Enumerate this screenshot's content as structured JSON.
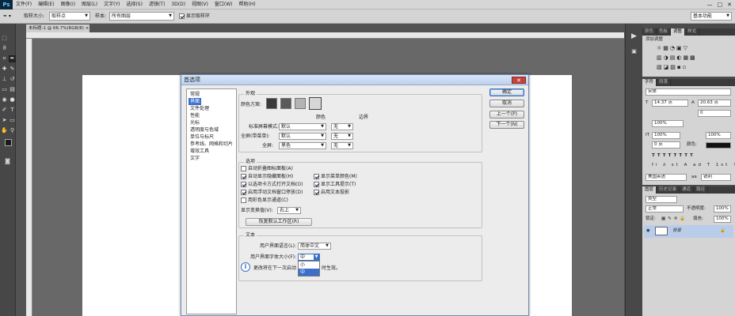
{
  "app": {
    "logo": "Ps",
    "window_controls": [
      "—",
      "□",
      "✕"
    ]
  },
  "menu": [
    "文件(F)",
    "编辑(E)",
    "图像(I)",
    "图层(L)",
    "文字(Y)",
    "选择(S)",
    "滤镜(T)",
    "3D(D)",
    "视图(V)",
    "窗口(W)",
    "帮助(H)"
  ],
  "options": {
    "sample_size_label": "取样大小:",
    "sample_size_value": "取样点",
    "sample_label": "样本:",
    "sample_value": "所有图层",
    "show_ring_label": "显示取样环",
    "show_ring_checked": true,
    "workspace": "基本功能"
  },
  "document": {
    "tab_title": "未标题-1 @ 66.7%(RGB/8) ×"
  },
  "panels": {
    "top_tabs": [
      "颜色",
      "色板",
      "调整",
      "样式"
    ],
    "adjust_title": "添加调整",
    "char_tabs": [
      "字符",
      "段落"
    ],
    "font_family": "宋体",
    "font_size": "14.37 点",
    "leading": "20.63 点",
    "tracking": "0",
    "vscale": "100%",
    "baseline": "0 点",
    "hscale": "100%",
    "color_label": "颜色:",
    "language": "美国英语",
    "aa": "锐利",
    "layer_tabs": [
      "图层",
      "历史记录",
      "通道",
      "路径"
    ],
    "kind": "类型",
    "blend_mode": "正常",
    "opacity_label": "不透明度:",
    "opacity": "100%",
    "lock_label": "锁定:",
    "fill_label": "填充:",
    "fill": "100%",
    "layer_name": "背景"
  },
  "dialog": {
    "title": "首选项",
    "close": "✕",
    "categories": [
      "常规",
      "界面",
      "文件处理",
      "性能",
      "光标",
      "透明度与色域",
      "单位与标尺",
      "参考线、网格和切片",
      "增效工具",
      "文字"
    ],
    "selected_category": 1,
    "buttons": {
      "ok": "确定",
      "cancel": "取消",
      "prev": "上一个(P)",
      "next": "下一个(N)"
    },
    "appearance": {
      "title": "外观",
      "color_scheme_label": "颜色方案:",
      "col_color": "颜色",
      "col_border": "边界",
      "rows": [
        {
          "label": "标准屏幕模式:",
          "color": "默认",
          "border": "无"
        },
        {
          "label": "全屏(带菜单):",
          "color": "默认",
          "border": "无"
        },
        {
          "label": "全屏:",
          "color": "黑色",
          "border": "无"
        }
      ],
      "swatch_colors": [
        "#3a3a3a",
        "#5a5a5a",
        "#b4b4b4",
        "#d6d6d6"
      ]
    },
    "options": {
      "title": "选项",
      "left": [
        {
          "label": "自动折叠图标面板(A)",
          "checked": false
        },
        {
          "label": "自动显示隐藏面板(H)",
          "checked": true
        },
        {
          "label": "以选项卡方式打开文档(O)",
          "checked": true
        },
        {
          "label": "启用浮动文档窗口停放(D)",
          "checked": true
        },
        {
          "label": "用彩色显示通道(C)",
          "checked": false
        }
      ],
      "right": [
        {
          "label": "显示菜单颜色(M)",
          "checked": true
        },
        {
          "label": "显示工具提示(T)",
          "checked": true
        },
        {
          "label": "启用文本投影",
          "checked": true
        }
      ],
      "transform_label": "显示变换值(V):",
      "transform_value": "右上",
      "reset_button": "恢复默认工作区(R)"
    },
    "text": {
      "title": "文本",
      "ui_lang_label": "用户界面语言(L):",
      "ui_lang_value": "简体中文",
      "ui_font_label": "用户界面字体大小(F):",
      "ui_font_value": "中",
      "dropdown_options": [
        "小",
        "中"
      ],
      "dropdown_selected": 1,
      "note_prefix": "更改将在下一次启动",
      "note_suffix": "时生效。"
    }
  }
}
